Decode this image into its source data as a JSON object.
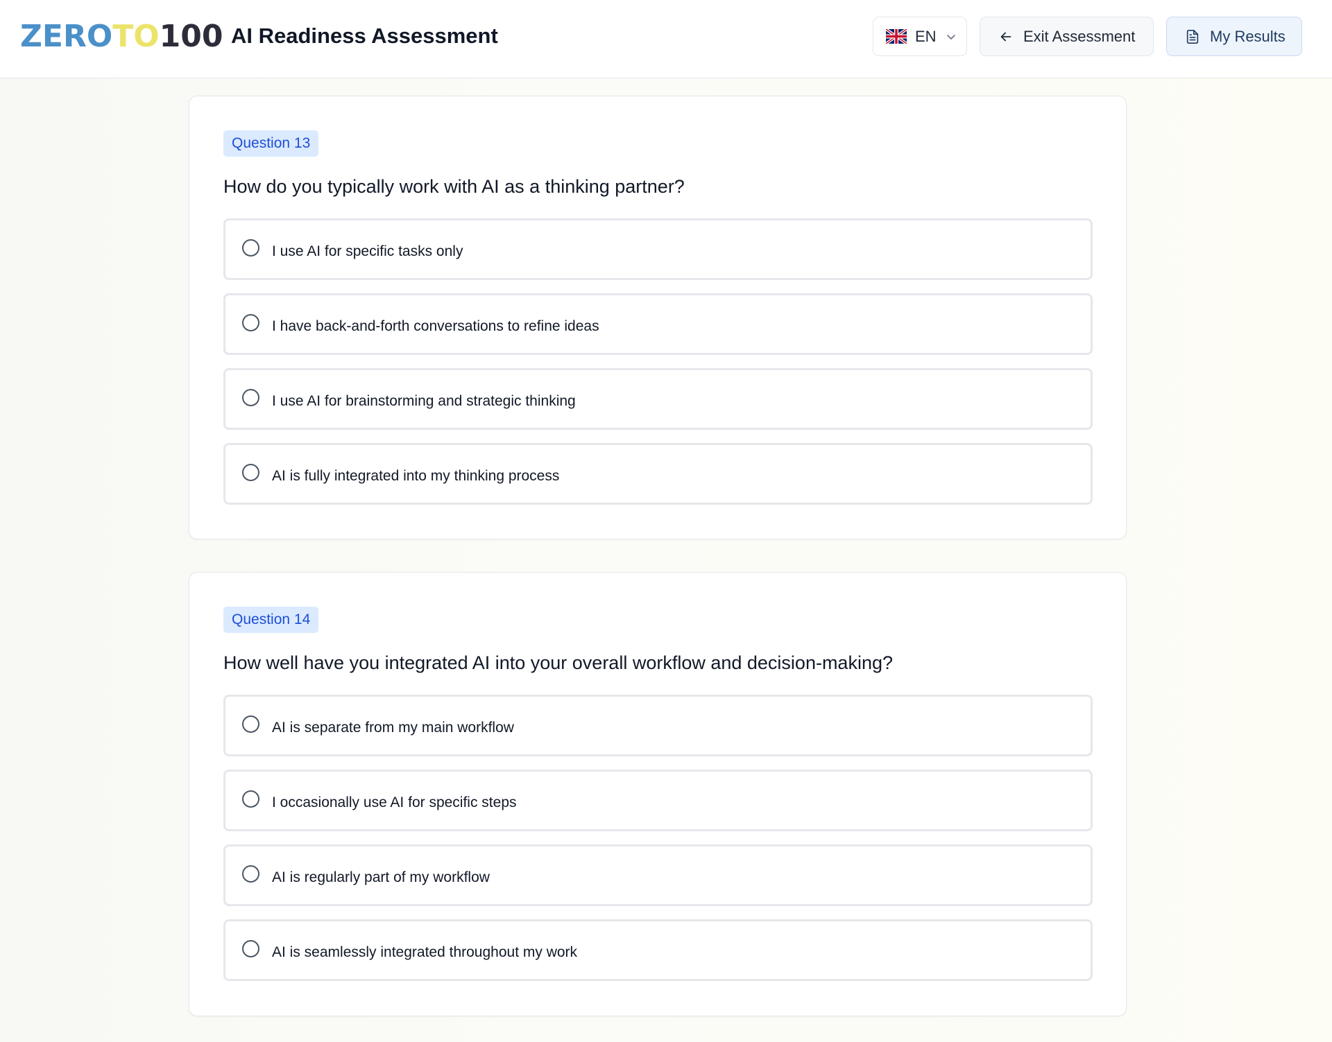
{
  "header": {
    "logo": {
      "part1": "ZERO",
      "part2": "TO",
      "part3": "100",
      "colors": {
        "part1": "#4a90c9",
        "part2": "#ece46a",
        "part3": "#2d2d3a"
      }
    },
    "title": "AI Readiness Assessment",
    "language": {
      "code": "EN",
      "flag_icon": "uk-flag-icon",
      "chevron_icon": "chevron-down-icon"
    },
    "exit_button": {
      "label": "Exit Assessment",
      "icon": "arrow-left-icon"
    },
    "results_button": {
      "label": "My Results",
      "icon": "document-icon"
    }
  },
  "questions": [
    {
      "badge": "Question 13",
      "text": "How do you typically work with AI as a thinking partner?",
      "options": [
        "I use AI for specific tasks only",
        "I have back-and-forth conversations to refine ideas",
        "I use AI for brainstorming and strategic thinking",
        "AI is fully integrated into my thinking process"
      ]
    },
    {
      "badge": "Question 14",
      "text": "How well have you integrated AI into your overall workflow and decision-making?",
      "options": [
        "AI is separate from my main workflow",
        "I occasionally use AI for specific steps",
        "AI is regularly part of my workflow",
        "AI is seamlessly integrated throughout my work"
      ]
    }
  ],
  "colors": {
    "badge_bg": "#dbeafe",
    "badge_text": "#1d4ed8",
    "accent": "#4a90c9"
  }
}
